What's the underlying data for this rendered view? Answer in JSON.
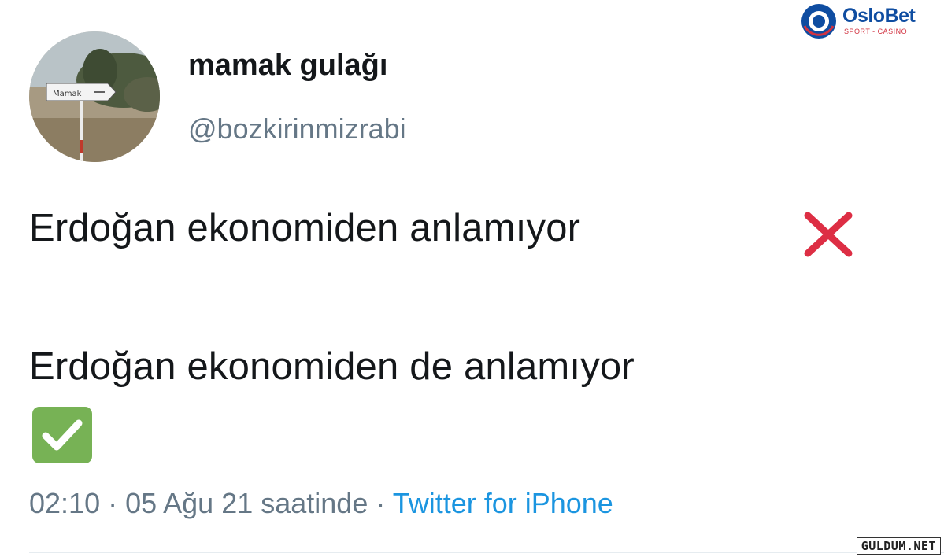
{
  "tweet": {
    "display_name": "mamak gulağı",
    "handle": "@bozkirinmizrabi",
    "line1_text": "Erdoğan ekonomiden anlamıyor",
    "line1_icon": "cross-mark-icon",
    "line2_text": "Erdoğan ekonomiden de anlamıyor",
    "line2_icon": "check-mark-button-icon",
    "avatar_sign_text": "Mamak",
    "meta_time": "02:10 · 05 Ağu 21 saatinde · ",
    "meta_source": "Twitter for iPhone"
  },
  "watermarks": {
    "brand_name": "OsloBet",
    "brand_tagline": "SPORT - CASINO",
    "site": "GULDUM.NET"
  },
  "colors": {
    "name_text": "#14171a",
    "secondary_text": "#657786",
    "link_blue": "#1b95e0",
    "cross_red": "#dd2e44",
    "check_green": "#77b255",
    "brand_blue": "#0f4da1",
    "brand_red": "#d23341"
  }
}
